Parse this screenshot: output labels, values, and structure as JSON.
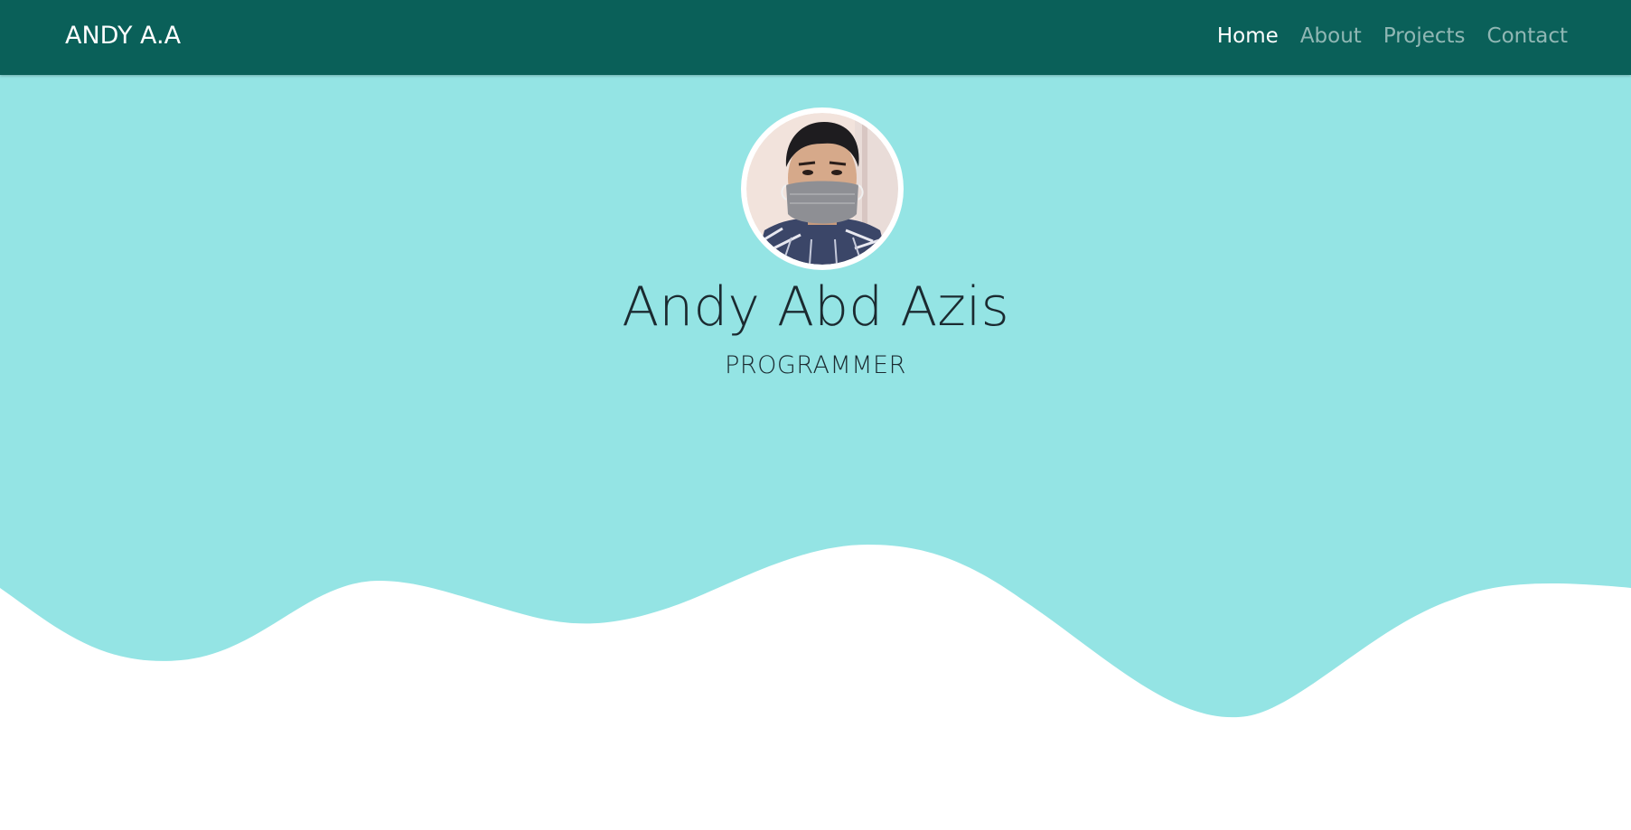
{
  "navbar": {
    "brand": "ANDY A.A",
    "background_color": "#0a6059",
    "links": [
      {
        "label": "Home",
        "active": true
      },
      {
        "label": "About",
        "active": false
      },
      {
        "label": "Projects",
        "active": false
      },
      {
        "label": "Contact",
        "active": false
      }
    ]
  },
  "hero": {
    "background_color": "#94e4e4",
    "avatar_icon": "profile-photo-masked-person",
    "name": "Andy Abd Azis",
    "role": "PROGRAMMER"
  }
}
